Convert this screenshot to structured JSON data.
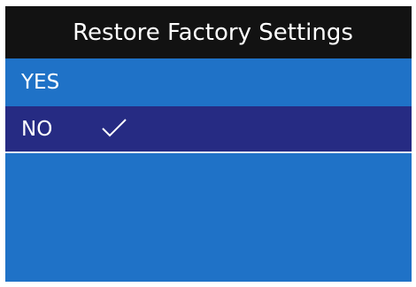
{
  "title": "Restore Factory Settings",
  "menu": {
    "items": [
      {
        "label": "YES",
        "selected": false
      },
      {
        "label": "NO",
        "selected": true
      }
    ],
    "selected_icon": "check-icon"
  },
  "colors": {
    "title_background": "#121212",
    "screen_background": "#1f72c7",
    "selected_background": "#262b83",
    "text": "#ffffff"
  }
}
